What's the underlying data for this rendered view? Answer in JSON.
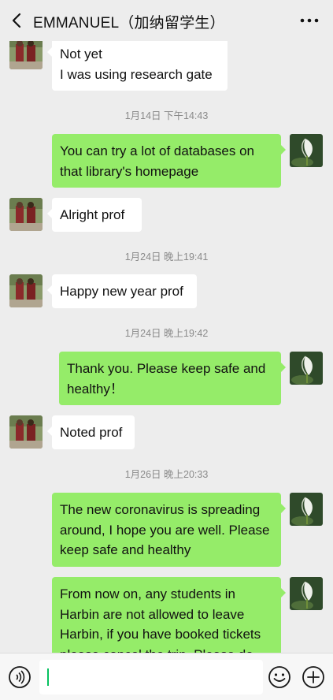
{
  "header": {
    "title": "EMMANUEL（加纳留学生）",
    "back_icon": "chevron-left-icon",
    "more_icon": "more-dots-icon"
  },
  "messages": {
    "m1_line1": "Not yet",
    "m1_line2": "I was using research gate",
    "ts1": "1月14日 下午14:43",
    "m2_line1": "You can try a lot of databases on",
    "m2_line2": "that library's homepage",
    "m3": "Alright prof",
    "ts2": "1月24日 晚上19:41",
    "m4": "Happy new year prof",
    "ts3": "1月24日 晚上19:42",
    "m5_line1": "Thank you. Please keep safe and",
    "m5_line2": "healthy！",
    "m6": "Noted prof",
    "ts4": "1月26日 晚上20:33",
    "m7_line1": "The new coronavirus is spreading",
    "m7_line2": "around, I hope you are well. Please",
    "m7_line3": "keep safe and healthy",
    "m8_line1": "From now on, any students in",
    "m8_line2": "Harbin are not allowed to leave",
    "m8_line3": "Harbin, if you have booked  tickets",
    "m8_line4": "please cancel the trip. Please do"
  },
  "colors": {
    "background": "#ededed",
    "incoming_bubble": "#ffffff",
    "outgoing_bubble": "#95ec69",
    "timestamp_text": "#8a8a8a"
  },
  "input_bar": {
    "voice_icon": "voice-icon",
    "emoji_icon": "emoji-icon",
    "plus_icon": "plus-icon",
    "input_value": ""
  }
}
